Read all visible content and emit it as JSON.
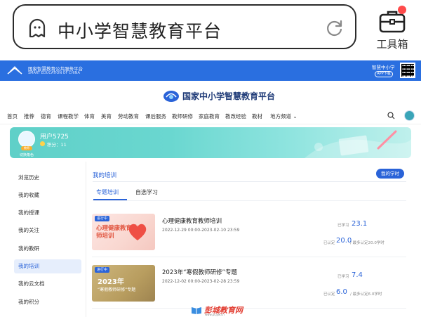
{
  "browser": {
    "search_text": "中小学智慧教育平台",
    "toolbox_label": "工具箱"
  },
  "site_header": {
    "name": "国家智慧教育公共服务平台",
    "sub": "SMART EDUCATION OF CHINA",
    "app_label": "智慧中小学",
    "app_button": "APP下载"
  },
  "brand": {
    "title": "国家中小学智慧教育平台"
  },
  "nav": {
    "items": [
      "首页",
      "推荐",
      "德育",
      "课程教学",
      "体育",
      "美育",
      "劳动教育",
      "课后服务",
      "教师研修",
      "家庭教育",
      "教改经验",
      "教材",
      "地方频道 ⌄"
    ]
  },
  "banner": {
    "username": "用户5725",
    "badge": "教师",
    "points": "积分：11",
    "switch_label": "切换角色"
  },
  "sidebar": {
    "items": [
      {
        "label": "浏览历史",
        "active": false
      },
      {
        "label": "我的收藏",
        "active": false
      },
      {
        "label": "我的授课",
        "active": false
      },
      {
        "label": "我的关注",
        "active": false
      },
      {
        "label": "我的教研",
        "active": false
      },
      {
        "label": "我的培训",
        "active": true
      },
      {
        "label": "我的云文档",
        "active": false
      },
      {
        "label": "我的积分",
        "active": false
      }
    ]
  },
  "main": {
    "title": "我的培训",
    "study_button": "我的学时",
    "tabs": [
      {
        "label": "专题培训",
        "active": true
      },
      {
        "label": "自选学习",
        "active": false
      }
    ],
    "cards": [
      {
        "badge": "进行中",
        "thumb_text": "心理健康教育教师培训",
        "title": "心理健康教育教师培训",
        "date": "2022-12-29 00:00-2023-02-10 23:59",
        "learned_label": "已学习",
        "learned": "23.1",
        "cert_label": "已认定",
        "cert": "20.0",
        "cert_min": "/ 最多认定20.0学时"
      },
      {
        "badge": "进行中",
        "thumb_text_a": "2023年",
        "thumb_text_b": "“寒假教师研修”专题",
        "title": "2023年“寒假教师研修”专题",
        "date": "2022-12-02 00:00-2023-02-28 23:59",
        "learned_label": "已学习",
        "learned": "7.4",
        "cert_label": "已认定",
        "cert": "6.0",
        "cert_min": "/ 最多认定6.0学时"
      }
    ]
  },
  "watermark": {
    "text": "彭城教育网",
    "url": "www.pcjyw.cn"
  },
  "colors": {
    "primary": "#2a63d8",
    "header_bg": "#2a6fe0",
    "banner": "#5fd0c8"
  }
}
